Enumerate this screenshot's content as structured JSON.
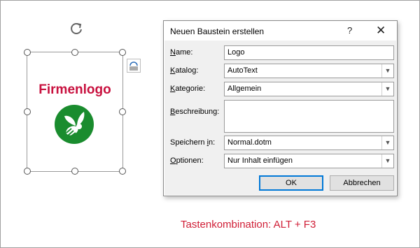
{
  "logo": {
    "text": "Firmenlogo",
    "brand_color": "#c8103e",
    "icon_color": "#1a8c2e",
    "icon": "wasp-logo-icon"
  },
  "dialog": {
    "title": "Neuen Baustein erstellen",
    "help": "?",
    "close": "✕",
    "fields": {
      "name": {
        "label_pre": "",
        "label_key": "N",
        "label_post": "ame:",
        "value": "Logo"
      },
      "katalog": {
        "label_pre": "",
        "label_key": "K",
        "label_post": "atalog:",
        "value": "AutoText"
      },
      "kategorie": {
        "label_pre": "",
        "label_key": "K",
        "label_post": "ategorie:",
        "value": "Allgemein"
      },
      "beschreibung": {
        "label_pre": "",
        "label_key": "B",
        "label_post": "eschreibung:",
        "value": ""
      },
      "speichern": {
        "label_pre": "Speichern ",
        "label_key": "i",
        "label_post": "n:",
        "value": "Normal.dotm"
      },
      "optionen": {
        "label_pre": "",
        "label_key": "O",
        "label_post": "ptionen:",
        "value": "Nur Inhalt einfügen"
      }
    },
    "ok_label": "OK",
    "cancel_label": "Abbrechen",
    "accent": "#0078d7"
  },
  "caption": "Tastenkombination: ALT + F3"
}
